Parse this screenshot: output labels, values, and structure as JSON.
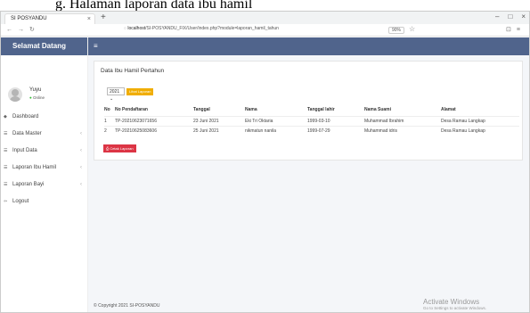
{
  "caption": "g.    Halaman laporan data ibu hamil",
  "browser": {
    "tab_title": "SI POSYANDU",
    "url_host": "localhost",
    "url_path": "/SI-POSYANDU_FIX/User/index.php?module=laporan_hamil_tahun",
    "zoom": "90%"
  },
  "sidebar": {
    "brand": "Selamat Datang",
    "user_name": "Yuyu",
    "user_status": "Online",
    "items": [
      {
        "label": "Dashboard",
        "icon": "dashboard-icon"
      },
      {
        "label": "Data Master",
        "icon": "list-icon"
      },
      {
        "label": "Input Data",
        "icon": "list-icon"
      },
      {
        "label": "Laporan Ibu Hamil",
        "icon": "list-icon"
      },
      {
        "label": "Laporan Bayi",
        "icon": "list-icon"
      },
      {
        "label": "Logout",
        "icon": "logout-icon"
      }
    ]
  },
  "main": {
    "card_title": "Data Ibu Hamil Pertahun",
    "year_value": "2021",
    "show_button": "Lihat Laporan",
    "print_button": "Cetak Laporan",
    "columns": [
      "No",
      "No Pendaftaran",
      "Tanggal",
      "Nama",
      "Tanggal lahir",
      "Nama Suami",
      "Alamat"
    ],
    "rows": [
      [
        "1",
        "TP-20210623071656",
        "23 Juni 2021",
        "Eki Tri Oktaria",
        "1999-03-10",
        "Muhammad Ibrahim",
        "Desa Ramau Langkap"
      ],
      [
        "2",
        "TP-20210625083606",
        "25 Juni 2021",
        "nikmatun nanila",
        "1999-07-29",
        "Muhammad idris",
        "Desa Ramau Langkap"
      ]
    ]
  },
  "footer": "© Copyright 2021 SI-POSYANDU",
  "watermark": {
    "title": "Activate Windows",
    "subtitle": "Go to Settings to activate Windows."
  },
  "colors": {
    "brand": "#50648c",
    "show_button": "#f0ad00",
    "print_button": "#dc3545"
  }
}
